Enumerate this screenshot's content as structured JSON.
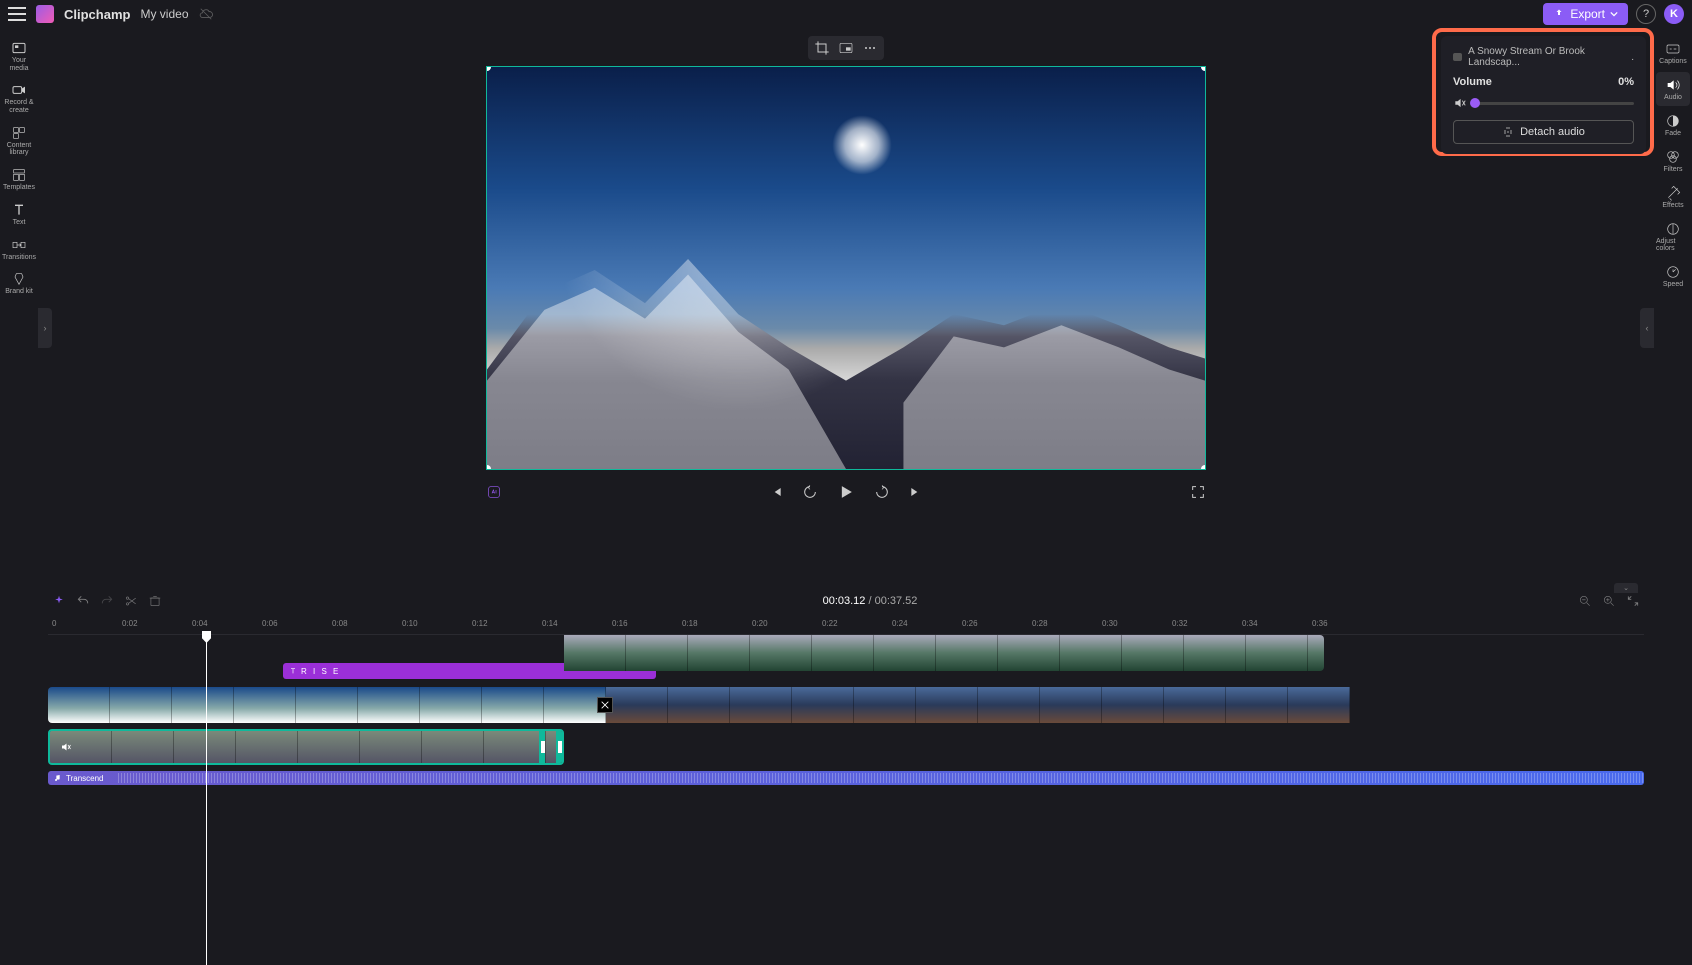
{
  "app": {
    "name": "Clipchamp",
    "project": "My video"
  },
  "topbar": {
    "export_label": "Export",
    "avatar_initial": "K"
  },
  "left_rail": [
    {
      "label": "Your media"
    },
    {
      "label": "Record & create"
    },
    {
      "label": "Content library"
    },
    {
      "label": "Templates"
    },
    {
      "label": "Text"
    },
    {
      "label": "Transitions"
    },
    {
      "label": "Brand kit"
    }
  ],
  "preview": {
    "aspect": "16:9"
  },
  "playback": {
    "current": "00:03.12",
    "total": "/ 00:37.52"
  },
  "timeline": {
    "ticks": [
      "0",
      "0:02",
      "0:04",
      "0:06",
      "0:08",
      "0:10",
      "0:12",
      "0:14",
      "0:16",
      "0:18",
      "0:20",
      "0:22",
      "0:24",
      "0:26",
      "0:28",
      "0:30",
      "0:32",
      "0:34",
      "0:36"
    ],
    "text_clip_label": "R I S E",
    "audio_clip_label": "Transcend"
  },
  "right_rail": [
    {
      "label": "Captions"
    },
    {
      "label": "Audio"
    },
    {
      "label": "Fade"
    },
    {
      "label": "Filters"
    },
    {
      "label": "Effects"
    },
    {
      "label": "Adjust colors"
    },
    {
      "label": "Speed"
    }
  ],
  "audio_panel": {
    "clip_name": "A Snowy Stream Or Brook Landscap...",
    "volume_label": "Volume",
    "volume_value": "0%",
    "detach_label": "Detach audio"
  }
}
